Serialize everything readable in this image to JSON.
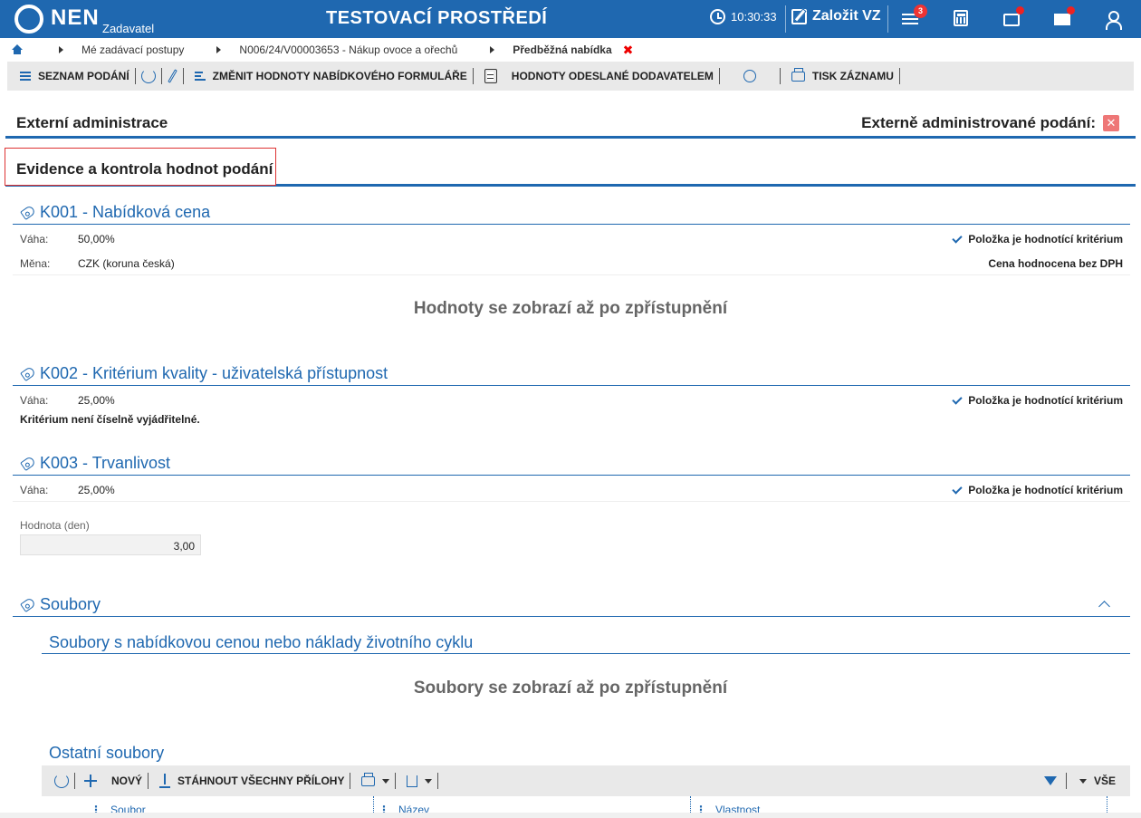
{
  "topbar": {
    "brand": "NEN",
    "brand_sub": "Zadavatel",
    "env_title": "TESTOVACÍ PROSTŘEDÍ",
    "clock": "10:30:33",
    "create_vz": "Založit VZ",
    "tasks_badge": "3"
  },
  "breadcrumb": {
    "items": [
      "Mé zadávací postupy",
      "N006/24/V00003653 - Nákup ovoce a ořechů"
    ],
    "current": "Předběžná nabídka",
    "close": "✖"
  },
  "toolbar": {
    "list_label": "SEZNAM PODÁNÍ",
    "change_label": "ZMĚNIT HODNOTY NABÍDKOVÉHO FORMULÁŘE",
    "sent_label": "HODNOTY ODESLANÉ DODAVATELEM",
    "print_label": "TISK ZÁZNAMU"
  },
  "ext_admin": {
    "title": "Externí administrace",
    "label": "Externě administrované podání:",
    "value_icon": "✕"
  },
  "evidence": {
    "title": "Evidence a kontrola hodnot podání"
  },
  "criteria": {
    "k001": {
      "title": "K001 - Nabídková cena",
      "weight_label": "Váha:",
      "weight": "50,00%",
      "currency_label": "Měna:",
      "currency": "CZK (koruna česká)",
      "flag": "Položka je hodnotící kritérium",
      "vat_note": "Cena hodnocena bez DPH",
      "placeholder": "Hodnoty se zobrazí až po zpřístupnění"
    },
    "k002": {
      "title": "K002 - Kritérium kvality - uživatelská přístupnost",
      "weight_label": "Váha:",
      "weight": "25,00%",
      "flag": "Položka je hodnotící kritérium",
      "note": "Kritérium není číselně vyjádřitelné."
    },
    "k003": {
      "title": "K003 - Trvanlivost",
      "weight_label": "Váha:",
      "weight": "25,00%",
      "flag": "Položka je hodnotící kritérium",
      "value_label": "Hodnota (den)",
      "value": "3,00"
    }
  },
  "files": {
    "title": "Soubory",
    "price_files_title": "Soubory s nabídkovou cenou nebo náklady životního cyklu",
    "price_files_placeholder": "Soubory se zobrazí až po zpřístupnění",
    "other_files_title": "Ostatní soubory",
    "grid_toolbar": {
      "new_label": "NOVÝ",
      "download_all_label": "STÁHNOUT VŠECHNY PŘÍLOHY",
      "all_label": "VŠE"
    },
    "columns": [
      "Soubor",
      "Název",
      "Vlastnost"
    ]
  },
  "colors": {
    "primary": "#1f68b0",
    "danger": "#e33333"
  }
}
